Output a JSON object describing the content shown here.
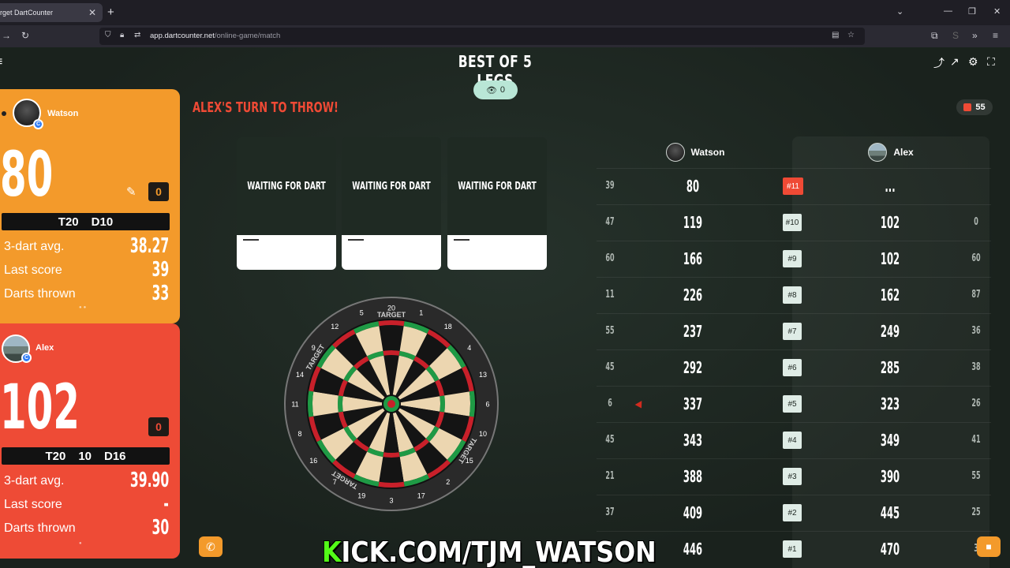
{
  "browser": {
    "tab_title": "rget DartCounter",
    "url_host": "app.dartcounter.net",
    "url_path": "/online-game/match"
  },
  "match": {
    "title": "BEST OF 5 LEGS",
    "spectators": "0",
    "turn_message": "ALEX'S TURN TO THROW!",
    "badge_count": "55"
  },
  "players": [
    {
      "name": "Watson",
      "score": "80",
      "legs": "0",
      "checkout": [
        "T20",
        "D10"
      ],
      "stats": [
        {
          "label": "3-dart avg.",
          "value": "38.27"
        },
        {
          "label": "Last score",
          "value": "39"
        },
        {
          "label": "Darts thrown",
          "value": "33"
        }
      ],
      "color": "#f39a2b"
    },
    {
      "name": "Alex",
      "score": "102",
      "legs": "0",
      "checkout": [
        "T20",
        "10",
        "D16"
      ],
      "stats": [
        {
          "label": "3-dart avg.",
          "value": "39.90"
        },
        {
          "label": "Last score",
          "value": "-"
        },
        {
          "label": "Darts thrown",
          "value": "30"
        }
      ],
      "color": "#ee4b36"
    }
  ],
  "darts": [
    {
      "status": "WAITING FOR DART"
    },
    {
      "status": "WAITING FOR DART"
    },
    {
      "status": "WAITING FOR DART"
    }
  ],
  "board": {
    "brand": "TARGET",
    "numbers": [
      "20",
      "1",
      "18",
      "4",
      "13",
      "6",
      "10",
      "15",
      "2",
      "17",
      "3",
      "19",
      "7",
      "16",
      "8",
      "11",
      "14",
      "9",
      "12",
      "5"
    ]
  },
  "scoreboard": {
    "headers": [
      "Watson",
      "Alex"
    ],
    "rows": [
      {
        "w_thrown": "39",
        "w_left": "80",
        "round": "#11",
        "a_left": "...",
        "a_thrown": "",
        "active": true
      },
      {
        "w_thrown": "47",
        "w_left": "119",
        "round": "#10",
        "a_left": "102",
        "a_thrown": "0"
      },
      {
        "w_thrown": "60",
        "w_left": "166",
        "round": "#9",
        "a_left": "102",
        "a_thrown": "60"
      },
      {
        "w_thrown": "11",
        "w_left": "226",
        "round": "#8",
        "a_left": "162",
        "a_thrown": "87"
      },
      {
        "w_thrown": "55",
        "w_left": "237",
        "round": "#7",
        "a_left": "249",
        "a_thrown": "36"
      },
      {
        "w_thrown": "45",
        "w_left": "292",
        "round": "#6",
        "a_left": "285",
        "a_thrown": "38"
      },
      {
        "w_thrown": "6",
        "w_left": "337",
        "round": "#5",
        "a_left": "323",
        "a_thrown": "26"
      },
      {
        "w_thrown": "45",
        "w_left": "343",
        "round": "#4",
        "a_left": "349",
        "a_thrown": "41"
      },
      {
        "w_thrown": "21",
        "w_left": "388",
        "round": "#3",
        "a_left": "390",
        "a_thrown": "55"
      },
      {
        "w_thrown": "37",
        "w_left": "409",
        "round": "#2",
        "a_left": "445",
        "a_thrown": "25"
      },
      {
        "w_thrown": "",
        "w_left": "446",
        "round": "#1",
        "a_left": "470",
        "a_thrown": "3"
      }
    ]
  },
  "overlay": {
    "kick_prefix": "K",
    "kick_rest": "ICK.COM/TJM_WATSON"
  }
}
